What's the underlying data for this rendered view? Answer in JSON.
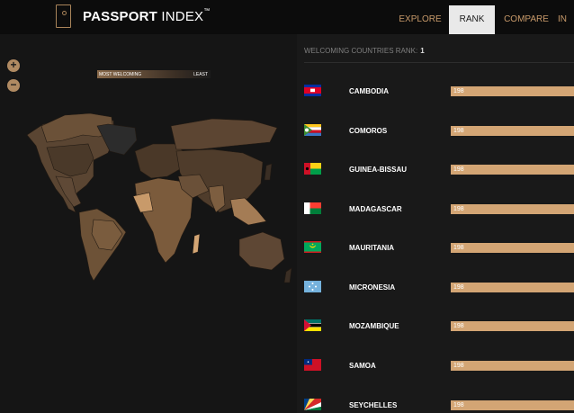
{
  "header": {
    "brand_bold": "PASSPORT",
    "brand_light": " INDEX",
    "brand_tm": "™",
    "nav": [
      "EXPLORE",
      "RANK",
      "COMPARE",
      "IN"
    ],
    "active_nav": "RANK"
  },
  "map": {
    "zoom_in": "+",
    "zoom_out": "−",
    "legend_most": "MOST WELCOMING",
    "legend_least": "LEAST"
  },
  "ranking": {
    "heading": "WELCOMING COUNTRIES RANK:",
    "rank": "1",
    "countries": [
      {
        "name": "CAMBODIA",
        "score": "198"
      },
      {
        "name": "COMOROS",
        "score": "198"
      },
      {
        "name": "GUINEA-BISSAU",
        "score": "198"
      },
      {
        "name": "MADAGASCAR",
        "score": "198"
      },
      {
        "name": "MAURITANIA",
        "score": "198"
      },
      {
        "name": "MICRONESIA",
        "score": "198"
      },
      {
        "name": "MOZAMBIQUE",
        "score": "198"
      },
      {
        "name": "SAMOA",
        "score": "198"
      },
      {
        "name": "SEYCHELLES",
        "score": "198"
      }
    ]
  },
  "colors": {
    "accent": "#d3a574",
    "nav_text": "#c89a6a",
    "background": "#191919"
  }
}
